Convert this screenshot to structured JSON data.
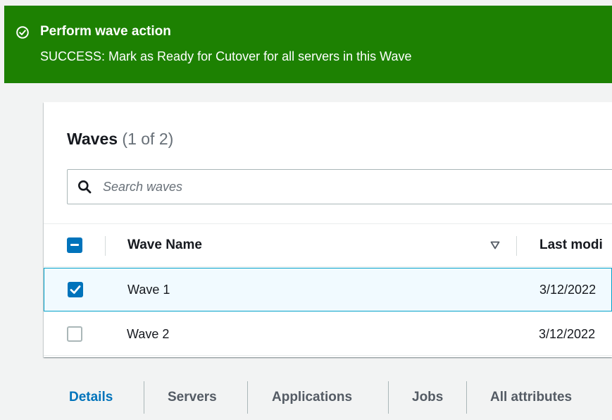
{
  "flash": {
    "title": "Perform wave action",
    "message": "SUCCESS: Mark as Ready for Cutover for all servers in this Wave",
    "color": "#1d8102",
    "icon": "check-circle-icon"
  },
  "table": {
    "title": "Waves",
    "count": "(1 of 2)",
    "search_placeholder": "Search waves",
    "search_value": "",
    "columns": [
      "Wave Name",
      "Last modi"
    ],
    "rows": [
      {
        "name": "Wave 1",
        "last_modified": "3/12/2022",
        "selected": true
      },
      {
        "name": "Wave 2",
        "last_modified": "3/12/2022",
        "selected": false
      }
    ],
    "accent": "#0073bb"
  },
  "tabs": [
    {
      "label": "Details",
      "active": true
    },
    {
      "label": "Servers",
      "active": false
    },
    {
      "label": "Applications",
      "active": false
    },
    {
      "label": "Jobs",
      "active": false
    },
    {
      "label": "All attributes",
      "active": false
    }
  ]
}
